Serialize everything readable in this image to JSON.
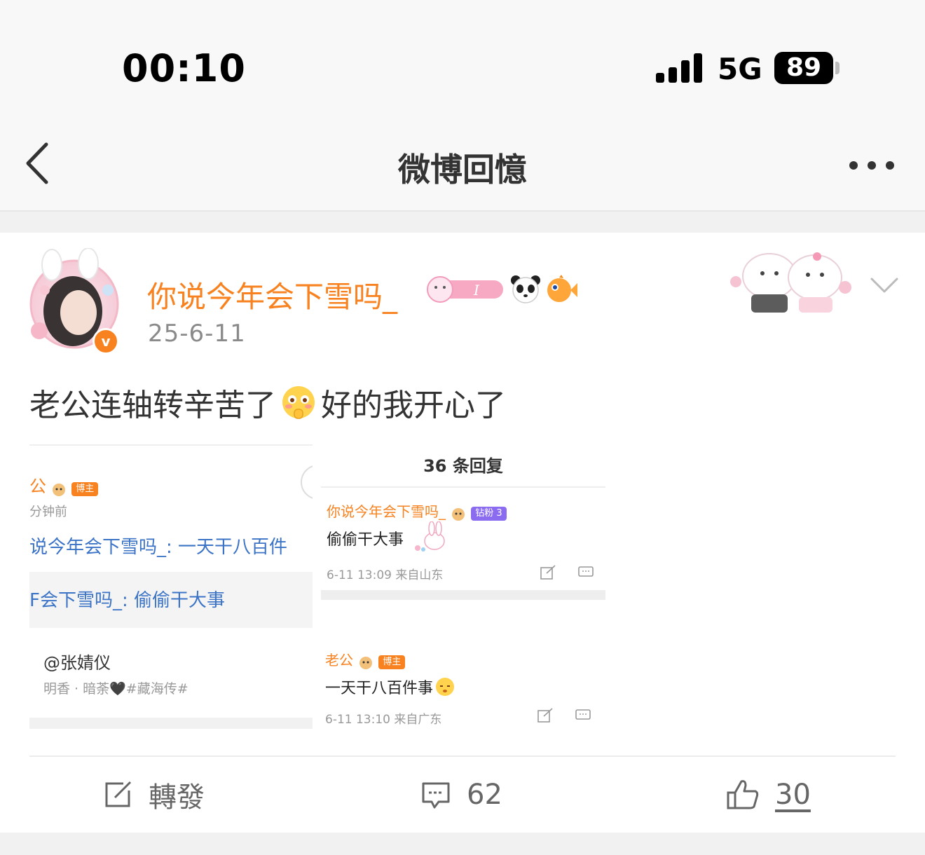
{
  "status_bar": {
    "time": "00:10",
    "network": "5G",
    "battery": "89"
  },
  "nav": {
    "title": "微博回憶"
  },
  "post": {
    "author": "你说今年会下雪吗_",
    "fan_badge_label": "I",
    "verified_mark": "v",
    "date": "25-6-11",
    "text_before_emoji": "老公连轴转辛苦了",
    "text_after_emoji": "好的我开心了"
  },
  "screenshot_left": {
    "name_fragment": "公",
    "tag": "博主",
    "time_fragment": "分钟前",
    "reply_line_1": "说今年会下雪吗_: 一天干八百件",
    "reply_line_2": "F会下雪吗_: 偷偷干大事",
    "mention": "@张婧仪",
    "mention_sub": "明香 · 暗荼🖤#藏海传#"
  },
  "screenshot_right": {
    "header": "36 条回复",
    "reply1": {
      "name": "你说今年会下雪吗_",
      "tag": "钻粉 3",
      "text": "偷偷干大事",
      "meta": "6-11 13:09  来自山东"
    },
    "reply2": {
      "name": "老公",
      "tag": "博主",
      "text": "一天干八百件事",
      "meta": "6-11 13:10  来自广东"
    }
  },
  "actions": {
    "repost_label": "轉發",
    "comment_count": "62",
    "like_count": "30"
  },
  "colors": {
    "accent": "#f7821f",
    "link_blue": "#3b73c6",
    "muted": "#8a8a8a"
  }
}
